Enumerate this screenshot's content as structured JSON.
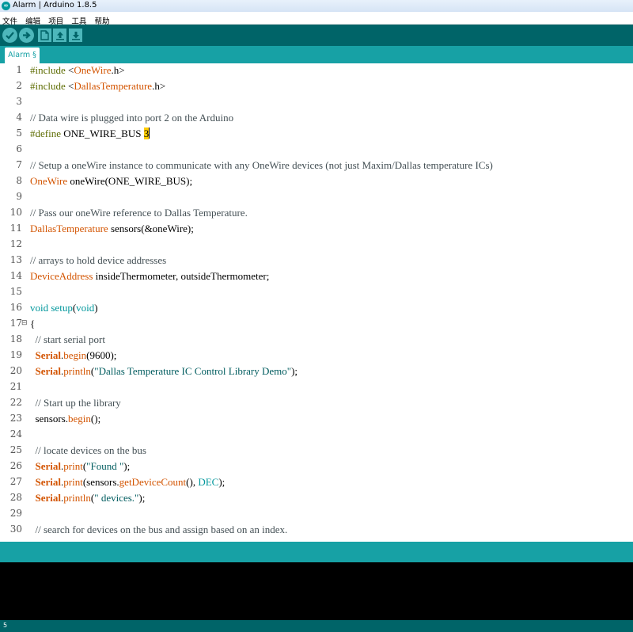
{
  "window": {
    "title": "Alarm | Arduino 1.8.5"
  },
  "menu": [
    "文件",
    "编辑",
    "项目",
    "工具",
    "帮助"
  ],
  "toolbar": {
    "buttons": [
      "verify-icon",
      "upload-icon",
      "new-icon",
      "open-icon",
      "save-icon"
    ]
  },
  "tabs": [
    {
      "label": "Alarm §"
    }
  ],
  "editor": {
    "lines": [
      [
        [
          "pre",
          "#include "
        ],
        [
          "plain",
          "<"
        ],
        [
          "type",
          "OneWire"
        ],
        [
          "plain",
          ".h>"
        ]
      ],
      [
        [
          "pre",
          "#include "
        ],
        [
          "plain",
          "<"
        ],
        [
          "type",
          "DallasTemperature"
        ],
        [
          "plain",
          ".h>"
        ]
      ],
      [],
      [
        [
          "comment",
          "// Data wire is plugged into port 2 on the Arduino"
        ]
      ],
      [
        [
          "pre",
          "#define "
        ],
        [
          "plain",
          "ONE_WIRE_BUS "
        ],
        [
          "hl",
          "3"
        ]
      ],
      [],
      [
        [
          "comment",
          "// Setup a oneWire instance to communicate with any OneWire devices (not just Maxim/Dallas temperature ICs)"
        ]
      ],
      [
        [
          "type",
          "OneWire"
        ],
        [
          "plain",
          " oneWire(ONE_WIRE_BUS);"
        ]
      ],
      [],
      [
        [
          "comment",
          "// Pass our oneWire reference to Dallas Temperature."
        ]
      ],
      [
        [
          "type",
          "DallasTemperature"
        ],
        [
          "plain",
          " sensors(&oneWire);"
        ]
      ],
      [],
      [
        [
          "comment",
          "// arrays to hold device addresses"
        ]
      ],
      [
        [
          "type",
          "DeviceAddress"
        ],
        [
          "plain",
          " insideThermometer, outsideThermometer;"
        ]
      ],
      [],
      [
        [
          "kw",
          "void"
        ],
        [
          "plain",
          " "
        ],
        [
          "kw",
          "setup"
        ],
        [
          "plain",
          "("
        ],
        [
          "kw",
          "void"
        ],
        [
          "plain",
          ")"
        ]
      ],
      [
        [
          "plain",
          "{"
        ]
      ],
      [
        [
          "comment",
          "  // start serial port"
        ]
      ],
      [
        [
          "plain",
          "  "
        ],
        [
          "serial",
          "Serial"
        ],
        [
          "plain",
          "."
        ],
        [
          "type",
          "begin"
        ],
        [
          "plain",
          "(9600);"
        ]
      ],
      [
        [
          "plain",
          "  "
        ],
        [
          "serial",
          "Serial"
        ],
        [
          "plain",
          "."
        ],
        [
          "type",
          "println"
        ],
        [
          "plain",
          "("
        ],
        [
          "str",
          "\"Dallas Temperature IC Control Library Demo\""
        ],
        [
          "plain",
          ");"
        ]
      ],
      [],
      [
        [
          "comment",
          "  // Start up the library"
        ]
      ],
      [
        [
          "plain",
          "  sensors."
        ],
        [
          "type",
          "begin"
        ],
        [
          "plain",
          "();"
        ]
      ],
      [],
      [
        [
          "comment",
          "  // locate devices on the bus"
        ]
      ],
      [
        [
          "plain",
          "  "
        ],
        [
          "serial",
          "Serial"
        ],
        [
          "plain",
          "."
        ],
        [
          "type",
          "print"
        ],
        [
          "plain",
          "("
        ],
        [
          "str",
          "\"Found \""
        ],
        [
          "plain",
          ");"
        ]
      ],
      [
        [
          "plain",
          "  "
        ],
        [
          "serial",
          "Serial"
        ],
        [
          "plain",
          "."
        ],
        [
          "type",
          "print"
        ],
        [
          "plain",
          "(sensors."
        ],
        [
          "type",
          "getDeviceCount"
        ],
        [
          "plain",
          "(), "
        ],
        [
          "kw",
          "DEC"
        ],
        [
          "plain",
          ");"
        ]
      ],
      [
        [
          "plain",
          "  "
        ],
        [
          "serial",
          "Serial"
        ],
        [
          "plain",
          "."
        ],
        [
          "type",
          "println"
        ],
        [
          "plain",
          "("
        ],
        [
          "str",
          "\" devices.\""
        ],
        [
          "plain",
          ");"
        ]
      ],
      [],
      [
        [
          "comment",
          "  // search for devices on the bus and assign based on an index."
        ]
      ]
    ]
  },
  "status": {
    "line": "5"
  },
  "colors": {
    "toolbar": "#006468",
    "accent": "#17a1a5",
    "type": "#d35400",
    "keyword": "#00979c",
    "highlight": "#ffcc00"
  }
}
